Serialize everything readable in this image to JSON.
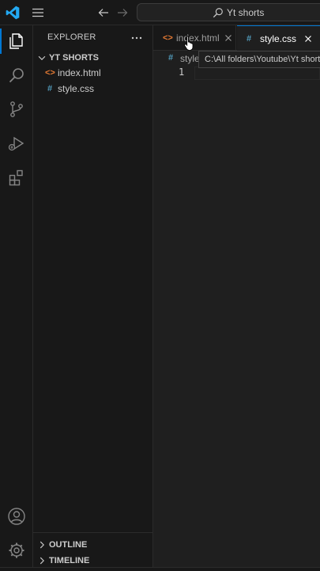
{
  "titlebar": {
    "search_text": "Yt shorts"
  },
  "explorer": {
    "title": "EXPLORER",
    "folder_name": "YT SHORTS",
    "files": [
      {
        "icon": "<>",
        "name": "index.html"
      },
      {
        "icon": "#",
        "name": "style.css"
      }
    ],
    "outline_label": "OUTLINE",
    "timeline_label": "TIMELINE"
  },
  "tabs": [
    {
      "icon": "<>",
      "label": "index.html",
      "active": false
    },
    {
      "icon": "#",
      "label": "style.css",
      "active": true
    }
  ],
  "editor": {
    "breadcrumb_icon": "#",
    "breadcrumb_text": "style",
    "line_number": "1",
    "tooltip_text": "C:\\All folders\\Youtube\\Yt shorts"
  },
  "colors": {
    "accent": "#0078d4",
    "html_icon": "#e37933",
    "css_icon": "#519aba"
  }
}
